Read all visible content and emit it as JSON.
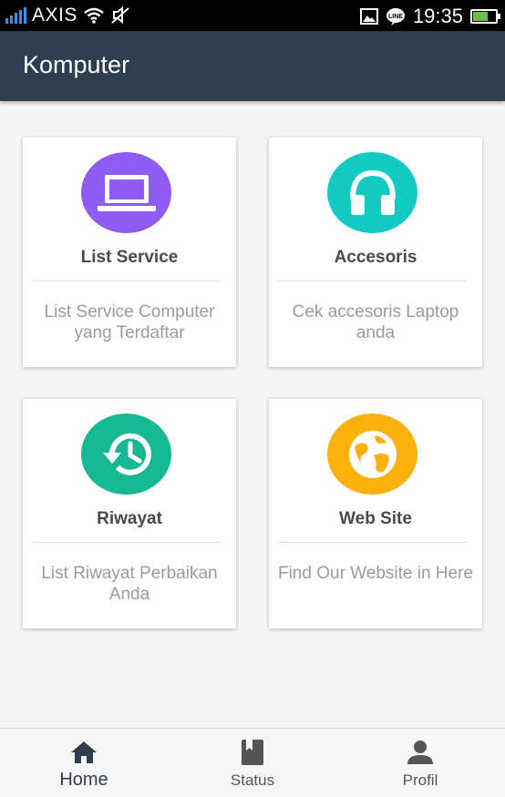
{
  "status_bar": {
    "carrier": "AXIS",
    "time": "19:35",
    "icons": [
      "signal-icon",
      "wifi-icon",
      "mute-icon",
      "image-icon",
      "line-icon",
      "battery-icon"
    ]
  },
  "app_bar": {
    "title": "Komputer"
  },
  "cards": [
    {
      "title": "List Service",
      "description": "List Service Computer yang Terdaftar",
      "icon": "laptop-icon",
      "color": "#8e5cf2"
    },
    {
      "title": "Accesoris",
      "description": "Cek accesoris Laptop anda",
      "icon": "headphones-icon",
      "color": "#13cac3"
    },
    {
      "title": "Riwayat",
      "description": "List Riwayat Perbaikan Anda",
      "icon": "history-icon",
      "color": "#15b892"
    },
    {
      "title": "Web Site",
      "description": "Find Our Website in Here",
      "icon": "globe-icon",
      "color": "#fbb00b"
    }
  ],
  "bottom_nav": {
    "items": [
      {
        "label": "Home",
        "icon": "home-icon",
        "active": true
      },
      {
        "label": "Status",
        "icon": "book-icon",
        "active": false
      },
      {
        "label": "Profil",
        "icon": "person-icon",
        "active": false
      }
    ]
  },
  "colors": {
    "app_bar": "#2e3e4e",
    "active_nav": "#2e3e4e",
    "inactive_nav": "#555555"
  }
}
